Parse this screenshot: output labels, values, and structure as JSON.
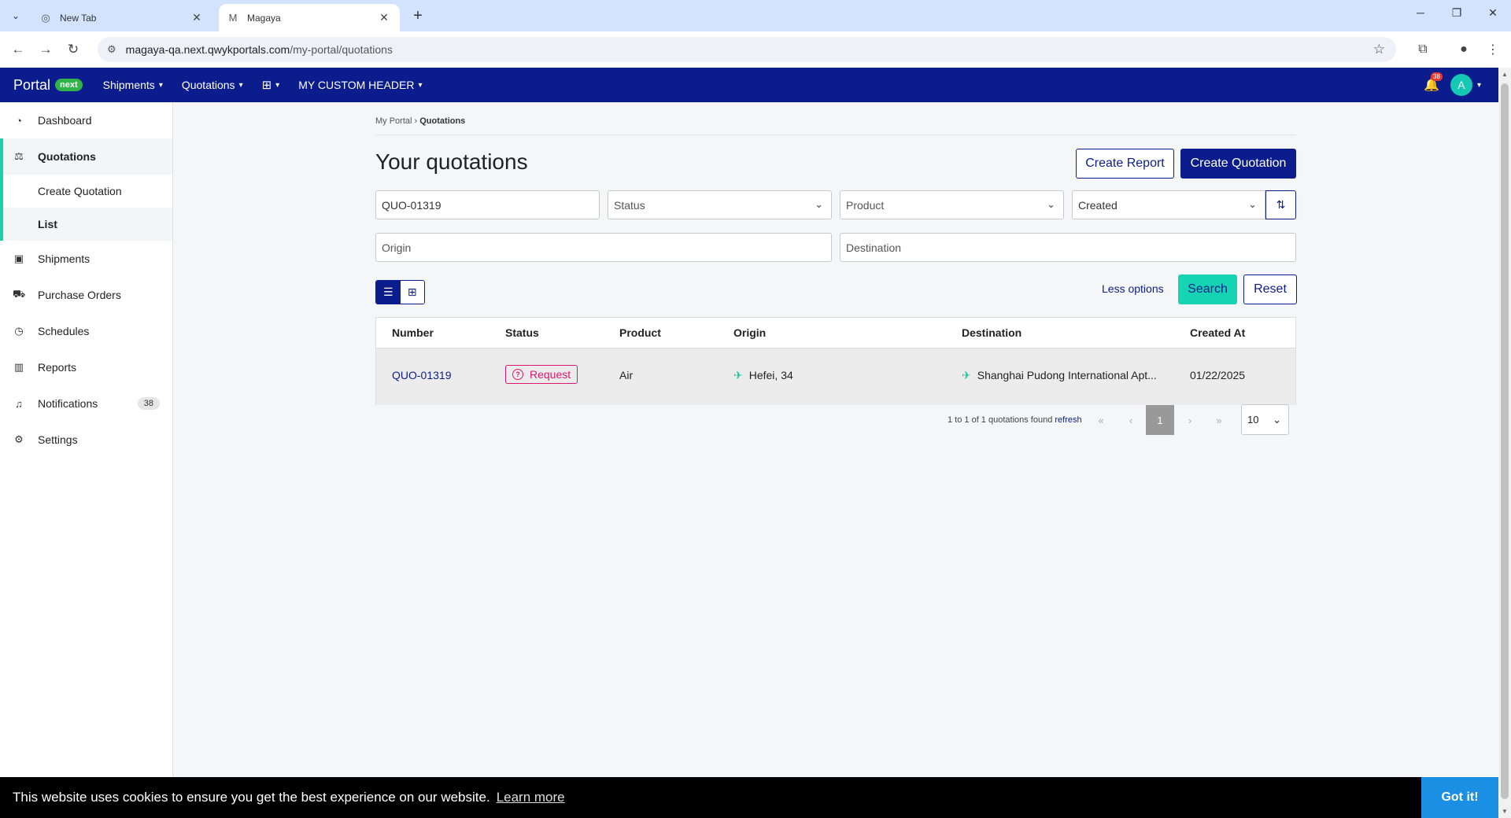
{
  "browser": {
    "tabs": [
      {
        "title": "New Tab",
        "icon": "chrome-icon"
      },
      {
        "title": "Magaya",
        "icon": "magaya-m-icon"
      }
    ],
    "url_host": "magaya-qa.next.qwykportals.com",
    "url_path": "/my-portal/quotations",
    "favicon_letter": "M"
  },
  "header": {
    "brand": "Portal",
    "brand_badge": "next",
    "nav": [
      "Shipments",
      "Quotations",
      "MY CUSTOM HEADER"
    ],
    "notification_count": "38",
    "avatar_initial": "A",
    "colors": {
      "primary": "#0b1d8c",
      "accent": "#16d4b3",
      "badge_green": "#2fb34a"
    }
  },
  "sidebar": {
    "items": [
      {
        "label": "Dashboard",
        "icon": "dashboard-icon"
      },
      {
        "label": "Quotations",
        "icon": "quotations-icon"
      },
      {
        "label": "Create Quotation"
      },
      {
        "label": "List"
      },
      {
        "label": "Shipments",
        "icon": "box-icon"
      },
      {
        "label": "Purchase Orders",
        "icon": "cart-icon"
      },
      {
        "label": "Schedules",
        "icon": "clock-icon"
      },
      {
        "label": "Reports",
        "icon": "chart-icon"
      },
      {
        "label": "Notifications",
        "icon": "bell-icon",
        "badge": "38"
      },
      {
        "label": "Settings",
        "icon": "gear-icon"
      }
    ]
  },
  "breadcrumb": {
    "root": "My Portal",
    "sep": " › ",
    "current": "Quotations"
  },
  "page": {
    "title": "Your quotations",
    "create_report": "Create Report",
    "create_quotation": "Create Quotation"
  },
  "filters": {
    "search_value": "QUO-01319",
    "status_placeholder": "Status",
    "product_placeholder": "Product",
    "sort_value": "Created",
    "origin_placeholder": "Origin",
    "destination_placeholder": "Destination",
    "less_options": "Less options",
    "search_button": "Search",
    "reset_button": "Reset"
  },
  "table": {
    "columns": [
      "Number",
      "Status",
      "Product",
      "Origin",
      "Destination",
      "Created At"
    ],
    "rows": [
      {
        "number": "QUO-01319",
        "status": "Request",
        "product": "Air",
        "origin": "Hefei, 34",
        "destination": "Shanghai Pudong International Apt...",
        "created_at": "01/22/2025"
      }
    ]
  },
  "pagination": {
    "summary": "1 to 1 of 1 quotations found",
    "refresh": "refresh",
    "current_page": "1",
    "page_size": "10"
  },
  "cookie": {
    "message": "This website uses cookies to ensure you get the best experience on our website.",
    "learn_more": "Learn more",
    "got_it": "Got it!"
  }
}
